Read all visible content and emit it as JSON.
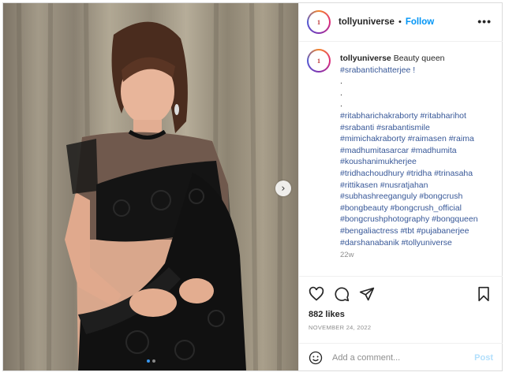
{
  "account": {
    "username": "tollyuniverse",
    "avatar_text": "1"
  },
  "header": {
    "separator": "•",
    "follow_label": "Follow",
    "more_label": "•••"
  },
  "caption": {
    "text": "Beauty queen",
    "first_tag": "#srabantichatterjee !",
    "dots": [
      ".",
      ".",
      "."
    ],
    "tag_lines": [
      "#ritabharichakraborty #ritabharihot",
      "#srabanti #srabantismile",
      "#mimichakraborty #raimasen #raima",
      "#madhumitasarcar #madhumita",
      "#koushanimukherjee",
      "#tridhachoudhury #tridha #trinasaha",
      "#rittikasen #nusratjahan",
      "#subhashreeganguly #bongcrush",
      "#bongbeauty #bongcrush_official",
      "#bongcrushphotography #bongqueen",
      "#bengaliactress #tbt #pujabanerjee",
      "#darshanabanik #tollyuniverse"
    ],
    "time": "22w"
  },
  "actions": {
    "likes": "882 likes",
    "date": "NOVEMBER 24, 2022"
  },
  "comment": {
    "placeholder": "Add a comment...",
    "post_label": "Post"
  },
  "carousel": {
    "next_glyph": "›",
    "slide_count": 2,
    "active_slide": 1
  },
  "colors": {
    "accent": "#0095f6",
    "hashtag": "#385898",
    "post_disabled": "#b2dffc"
  }
}
